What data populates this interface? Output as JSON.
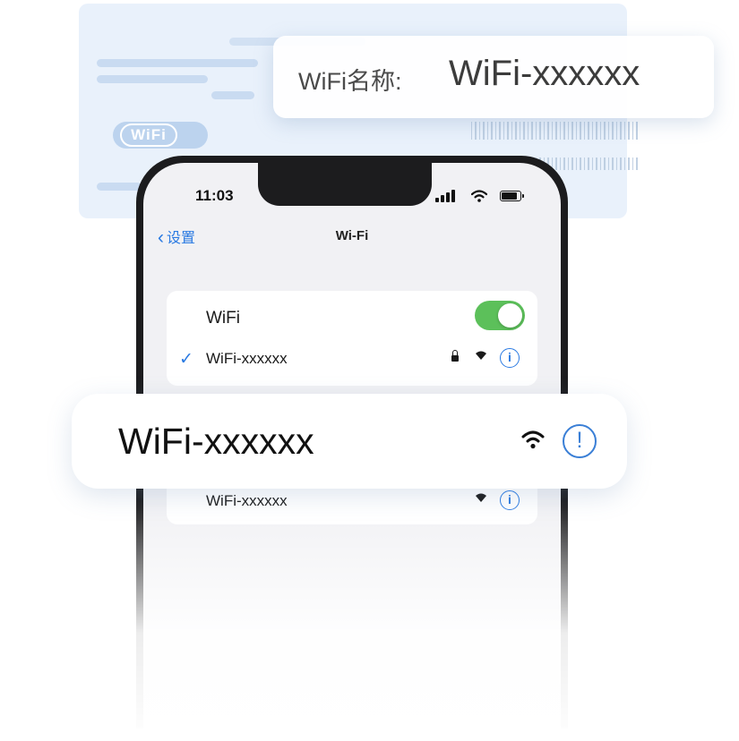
{
  "label_card": {
    "wifi_badge": "WiFi"
  },
  "name_callout": {
    "label": "WiFi名称:",
    "value": "WiFi-xxxxxx"
  },
  "phone": {
    "status_bar": {
      "time": "11:03"
    },
    "nav": {
      "back_label": "设置",
      "title": "Wi-Fi"
    },
    "wifi_toggle": {
      "label": "WiFi",
      "on": true,
      "color": "#5cc05a"
    },
    "connected_network": {
      "check": "✓",
      "name": "WiFi-xxxxxx",
      "secured": true
    },
    "other_network": {
      "name": "WiFi-xxxxxx"
    }
  },
  "banner": {
    "network_name": "WiFi-xxxxxx",
    "info_glyph": "!"
  },
  "colors": {
    "accent": "#2a7ae2",
    "toggle_on": "#5cc05a",
    "card_bg": "#e9f1fb"
  }
}
